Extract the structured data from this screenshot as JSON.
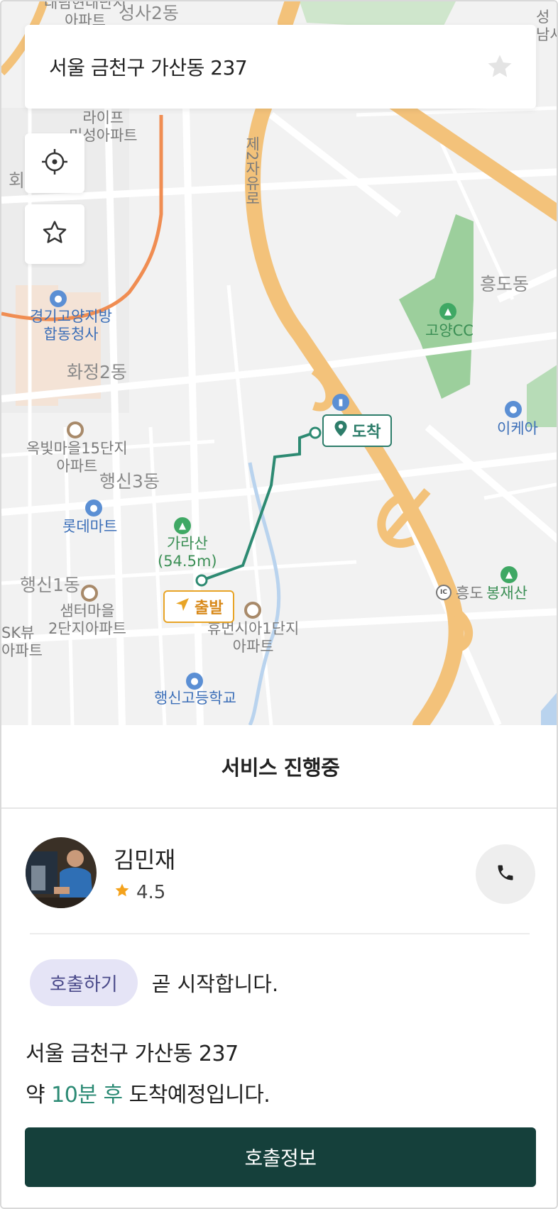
{
  "map": {
    "labels": {
      "l1": "대림현대단지\n아파트",
      "l2": "성사2동",
      "l3": "라이프\n미성아파트",
      "l4": "회",
      "l5": "경기고양지방\n합동청사",
      "l6": "화정2동",
      "l7": "옥빛마을15단지\n아파트",
      "l8": "행신3동",
      "l9": "롯데마트",
      "l10": "가라산\n(54.5m)",
      "l11": "행신1동",
      "l12": "샘터마을\n2단지아파트",
      "l13": "SK뷰\n아파트",
      "l14": "휴먼시아1단지\n아파트",
      "l15": "행신고등학교",
      "l16": "흥도동",
      "l17": "고양CC",
      "l18": "이케아",
      "l19": "흥도",
      "l20": "봉재산",
      "l21": "성\n남사",
      "l22": "제2자유로"
    }
  },
  "address_bar": {
    "text": "서울 금천구 가산동 237",
    "favorite_icon": "star-icon"
  },
  "controls": {
    "locate_icon": "crosshair-icon",
    "favorite_icon": "star-outline-icon"
  },
  "route": {
    "destination_label": "도착",
    "start_label": "출발",
    "route_color": "#2d8a72"
  },
  "sheet": {
    "title": "서비스 진행중",
    "driver": {
      "name": "김민재",
      "rating": "4.5"
    },
    "status": {
      "chip": "호출하기",
      "text": "곧 시작합니다."
    },
    "destination": "서울 금천구 가산동 237",
    "eta": {
      "prefix": "약 ",
      "highlight": "10분 후",
      "suffix": " 도착예정입니다."
    },
    "info_button": "호출정보"
  },
  "colors": {
    "accent": "#15403b",
    "route": "#2d8a72",
    "start_marker": "#e8a426",
    "chip_bg": "#e5e4f6"
  }
}
